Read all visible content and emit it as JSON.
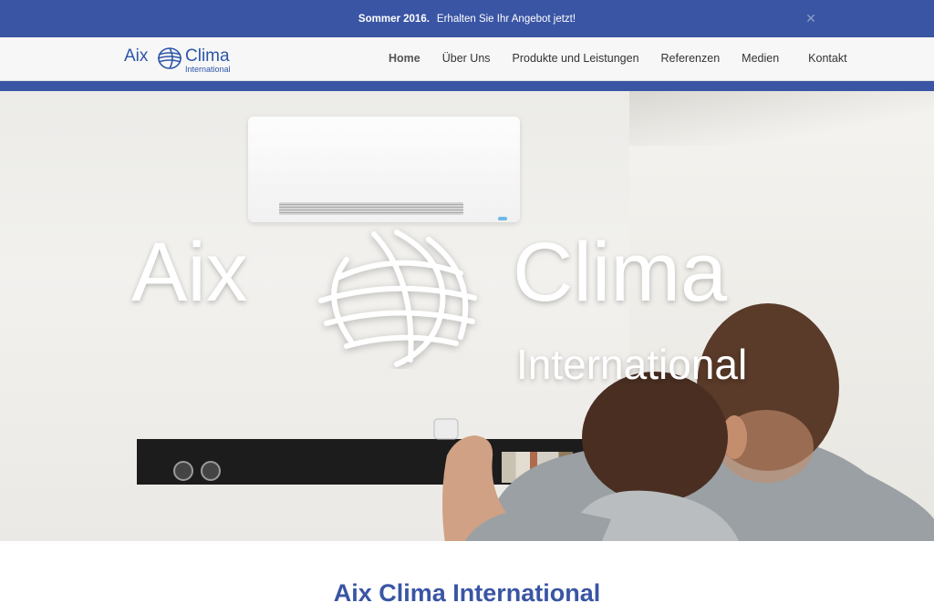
{
  "promo": {
    "strong_text": "Sommer 2016.",
    "text": "Erhalten Sie Ihr Angebot jetzt!",
    "close_glyph": "✕"
  },
  "logo": {
    "word1": "Aix",
    "word2": "Clima",
    "word3": "International",
    "icon": "globe-icon"
  },
  "nav": {
    "items": [
      {
        "label": "Home",
        "active": true
      },
      {
        "label": "Über Uns",
        "active": false
      },
      {
        "label": "Produkte und Leistungen",
        "active": false
      },
      {
        "label": "Referenzen",
        "active": false
      },
      {
        "label": "Medien",
        "active": false
      },
      {
        "label": "Kontakt",
        "active": false
      }
    ]
  },
  "hero": {
    "logo_word1": "Aix",
    "logo_word2": "Clima",
    "logo_word3": "International"
  },
  "section": {
    "title": "Aix Clima International"
  },
  "colors": {
    "brand_blue": "#3a55a4",
    "logo_blue": "#2d56a8"
  }
}
